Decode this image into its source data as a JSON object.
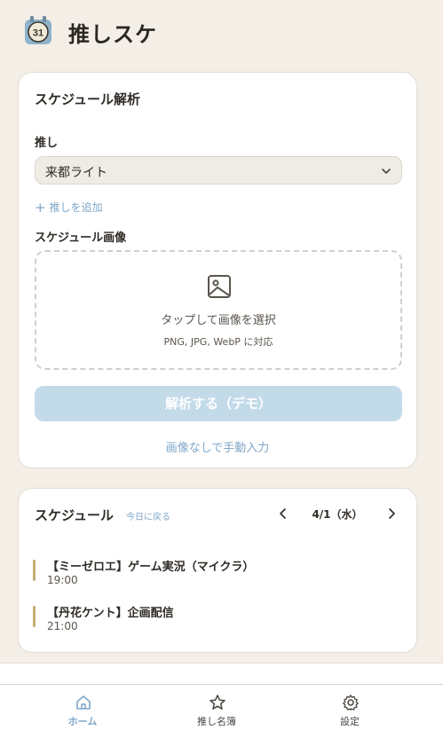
{
  "app": {
    "title": "推しスケ",
    "logo_text": "31",
    "logo_icon": "calendar-logo-icon"
  },
  "analysis_card": {
    "title": "スケジュール解析",
    "oshi_label": "推し",
    "selected_oshi": "来都ライト",
    "add_oshi": "推しを追加",
    "image_label": "スケジュール画像",
    "drop_main": "タップして画像を選択",
    "drop_sub": "PNG, JPG, WebP に対応",
    "analyze_button": "解析する（デモ）",
    "manual_link": "画像なしで手動入力"
  },
  "schedule_card": {
    "title": "スケジュール",
    "today_link": "今日に戻る",
    "date": "4/1（水）",
    "events": [
      {
        "title": "【ミーゼロエ】ゲーム実況（マイクラ）",
        "time": "19:00"
      },
      {
        "title": "【丹花ケント】企画配信",
        "time": "21:00"
      }
    ]
  },
  "tabbar": {
    "items": [
      {
        "label": "ホーム",
        "icon": "home-icon",
        "active": true
      },
      {
        "label": "推し名簿",
        "icon": "star-icon",
        "active": false
      },
      {
        "label": "設定",
        "icon": "gear-icon",
        "active": false
      }
    ]
  },
  "colors": {
    "background": "#f3eee6",
    "accent": "#7fa6c7",
    "button_disabled": "#c3dae9",
    "event_bar": "#c4ad72"
  }
}
